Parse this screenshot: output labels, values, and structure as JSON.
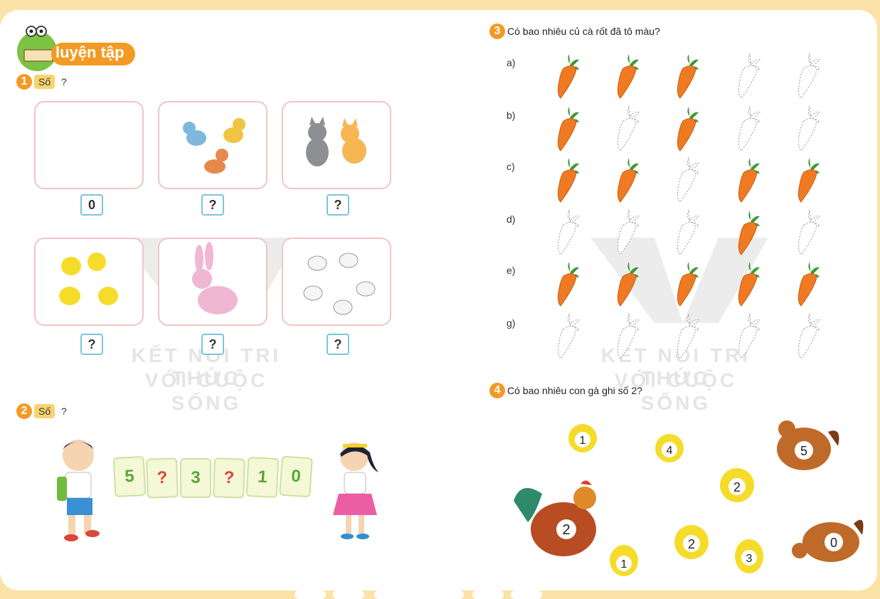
{
  "title": "luyện tập",
  "exercise1": {
    "number": "1",
    "tag": "Số",
    "question_mark": "?",
    "answers": [
      "0",
      "?",
      "?",
      "?",
      "?",
      "?"
    ]
  },
  "exercise2": {
    "number": "2",
    "tag": "Số",
    "question_mark": "?",
    "sequence": [
      "5",
      "?",
      "3",
      "?",
      "1",
      "0"
    ]
  },
  "exercise3": {
    "number": "3",
    "question": "Có bao nhiêu củ cà rốt đã tô màu?",
    "rows": [
      {
        "label": "a)",
        "colored": [
          true,
          true,
          true,
          false,
          false
        ]
      },
      {
        "label": "b)",
        "colored": [
          true,
          false,
          true,
          false,
          false
        ]
      },
      {
        "label": "c)",
        "colored": [
          true,
          true,
          false,
          true,
          true
        ]
      },
      {
        "label": "d)",
        "colored": [
          false,
          false,
          false,
          true,
          false
        ]
      },
      {
        "label": "e)",
        "colored": [
          true,
          true,
          true,
          true,
          true
        ]
      },
      {
        "label": "g)",
        "colored": [
          false,
          false,
          false,
          false,
          false
        ]
      }
    ]
  },
  "exercise4": {
    "number": "4",
    "question": "Có bao nhiêu con gà ghi số 2?",
    "labels": [
      "1",
      "4",
      "5",
      "2",
      "2",
      "1",
      "2",
      "3",
      "0"
    ]
  },
  "watermark": {
    "line1": "KẾT NỐI TRI THỨC",
    "line2": "VỚI CUỘC SỐNG"
  },
  "colors": {
    "accent": "#f39a24",
    "background": "#fbe3a8",
    "carrot": "#f07a22",
    "leaf": "#3e9a3a",
    "tag": "#f8d36f"
  }
}
